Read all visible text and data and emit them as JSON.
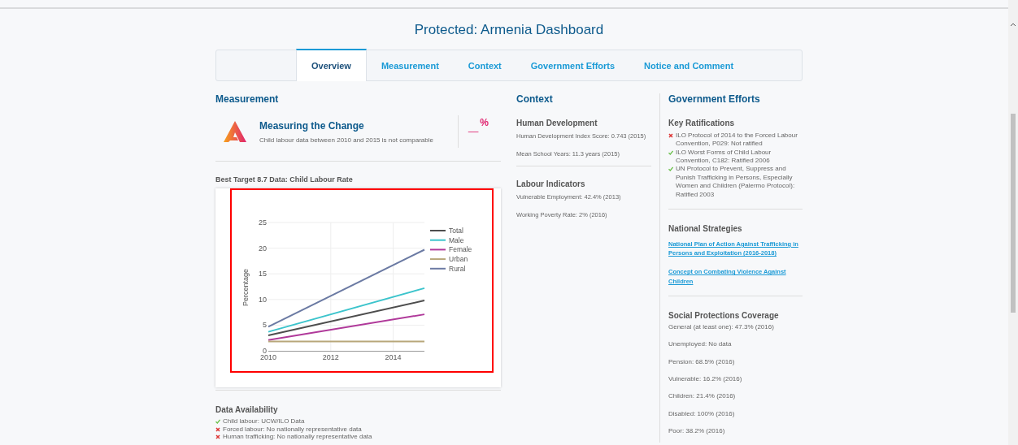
{
  "page_title": "Protected: Armenia Dashboard",
  "tabs": [
    {
      "label": "Overview",
      "selected": true
    },
    {
      "label": "Measurement",
      "selected": false
    },
    {
      "label": "Context",
      "selected": false
    },
    {
      "label": "Government Efforts",
      "selected": false
    },
    {
      "label": "Notice and Comment",
      "selected": false
    }
  ],
  "measurement": {
    "heading": "Measurement",
    "card_title": "Measuring the Change",
    "card_text": "Child labour data between 2010 and 2015 is not comparable",
    "value": "_",
    "unit": "%",
    "chart_title": "Best Target 8.7 Data: Child Labour Rate",
    "chart_data": {
      "type": "line",
      "grid": true,
      "legend": true,
      "ylabel": "Percentage",
      "x": [
        2010,
        2015
      ],
      "xlim": [
        2010,
        2015
      ],
      "ylim": [
        0,
        25
      ],
      "xticks": [
        2010,
        2012,
        2014
      ],
      "yticks": [
        0,
        5,
        10,
        15,
        20,
        25
      ],
      "series": [
        {
          "name": "Total",
          "color": "#4d4d4d",
          "values": [
            3.0,
            9.8
          ]
        },
        {
          "name": "Male",
          "color": "#3cc4cc",
          "values": [
            3.7,
            12.2
          ]
        },
        {
          "name": "Female",
          "color": "#b0399a",
          "values": [
            2.1,
            7.1
          ]
        },
        {
          "name": "Urban",
          "color": "#b8a77a",
          "values": [
            1.8,
            1.8
          ]
        },
        {
          "name": "Rural",
          "color": "#6b7aa3",
          "values": [
            4.7,
            19.7
          ]
        }
      ]
    },
    "availability_heading": "Data Availability",
    "availability": [
      {
        "text": "Child labour: UCW/ILO Data",
        "available": true
      },
      {
        "text": "Forced labour: No nationally representative data",
        "available": false
      },
      {
        "text": "Human trafficking: No nationally representative data",
        "available": false
      }
    ]
  },
  "context": {
    "heading": "Context",
    "sections": [
      {
        "title": "Human Development",
        "items": [
          "Human Development Index Score: 0.743 (2015)",
          "Mean School Years: 11.3 years (2015)"
        ]
      },
      {
        "title": "Labour Indicators",
        "items": [
          "Vulnerable Employment:  42.4% (2013)",
          "Working Poverty Rate: 2% (2016)"
        ]
      }
    ]
  },
  "government": {
    "heading": "Government Efforts",
    "ratifications_title": "Key Ratifications",
    "ratifications": [
      {
        "text": "ILO Protocol of 2014 to the Forced Labour Convention, P029: Not ratified",
        "ratified": false
      },
      {
        "text": "ILO Worst Forms of Child Labour Convention, C182: Ratified 2006",
        "ratified": true
      },
      {
        "text": "UN Protocol to Prevent, Suppress and Punish Trafficking in Persons, Especially Women and Children (Palermo Protocol): Ratified 2003",
        "ratified": true
      }
    ],
    "strategies_title": "National Strategies",
    "strategies": [
      "National Plan of Action Against Trafficking in Persons and Exploitation (2016-2018)",
      "Concept on Combating Violence Against Children"
    ],
    "coverage_title": "Social Protections Coverage",
    "coverage": [
      "General (at least one): 47.3% (2016)",
      "Unemployed: No data",
      "Pension: 68.5% (2016)",
      "Vulnerable: 16.2% (2016)",
      "Children: 21.4% (2016)",
      "Disabled: 100% (2016)",
      "Poor: 38.2% (2016)"
    ]
  }
}
